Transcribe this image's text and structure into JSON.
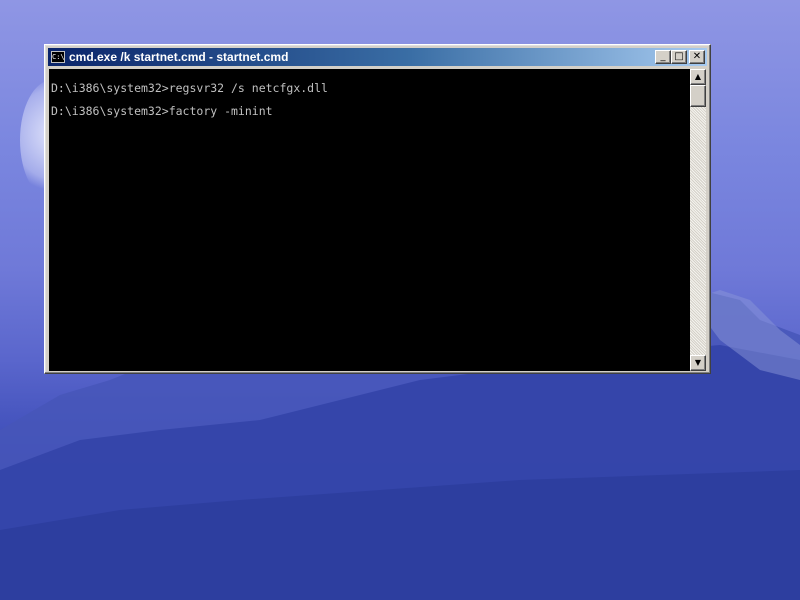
{
  "window": {
    "title": "cmd.exe /k startnet.cmd - startnet.cmd",
    "icon_label": "C:\\",
    "icons": [
      "cmd-icon",
      "minimize-icon",
      "maximize-icon",
      "close-icon"
    ],
    "controls": {
      "minimize": "_",
      "maximize": "□",
      "close": "✕"
    }
  },
  "console": {
    "lines": [
      "D:\\i386\\system32>regsvr32 /s netcfgx.dll",
      "D:\\i386\\system32>factory -minint"
    ]
  },
  "scrollbar": {
    "up": "▲",
    "down": "▼"
  },
  "colors": {
    "titlebar_start": "#0a246a",
    "titlebar_end": "#a6caf0",
    "console_bg": "#000000",
    "console_fg": "#c0c0c0"
  }
}
